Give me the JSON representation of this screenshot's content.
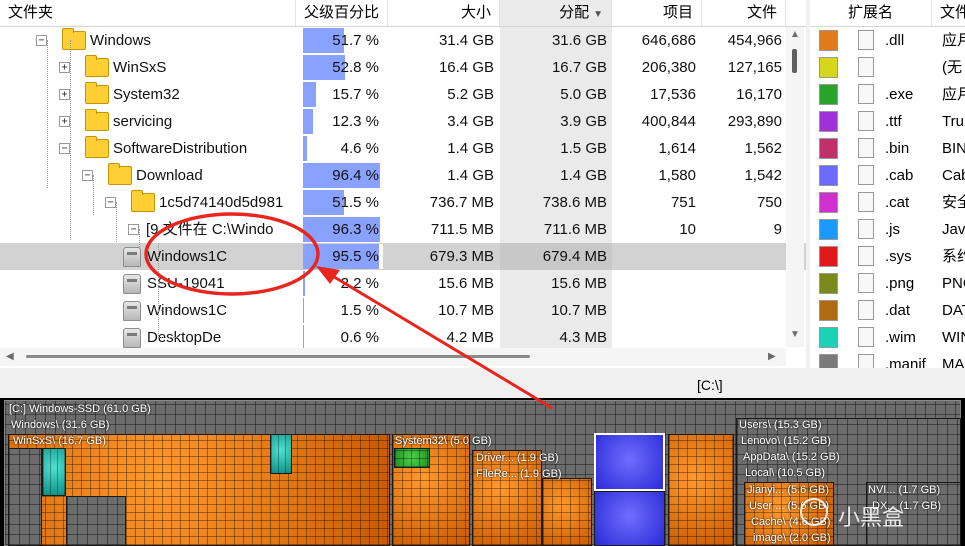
{
  "columns": {
    "folder": "文件夹",
    "parent_pct": "父级百分比",
    "size": "大小",
    "alloc": "分配",
    "items": "项目",
    "files": "文件"
  },
  "rows": [
    {
      "name": "Windows",
      "pct": "51.7 %",
      "pct_value": 0.517,
      "size": "31.4 GB",
      "alloc": "31.6 GB",
      "items": "646,686",
      "files": "454,966"
    },
    {
      "name": "WinSxS",
      "pct": "52.8 %",
      "pct_value": 0.528,
      "size": "16.4 GB",
      "alloc": "16.7 GB",
      "items": "206,380",
      "files": "127,165"
    },
    {
      "name": "System32",
      "pct": "15.7 %",
      "pct_value": 0.157,
      "size": "5.2 GB",
      "alloc": "5.0 GB",
      "items": "17,536",
      "files": "16,170"
    },
    {
      "name": "servicing",
      "pct": "12.3 %",
      "pct_value": 0.123,
      "size": "3.4 GB",
      "alloc": "3.9 GB",
      "items": "400,844",
      "files": "293,890"
    },
    {
      "name": "SoftwareDistribution",
      "pct": "4.6 %",
      "pct_value": 0.046,
      "size": "1.4 GB",
      "alloc": "1.5 GB",
      "items": "1,614",
      "files": "1,562"
    },
    {
      "name": "Download",
      "pct": "96.4 %",
      "pct_value": 0.964,
      "size": "1.4 GB",
      "alloc": "1.4 GB",
      "items": "1,580",
      "files": "1,542"
    },
    {
      "name": "1c5d74140d5d981",
      "pct": "51.5 %",
      "pct_value": 0.515,
      "size": "736.7 MB",
      "alloc": "738.6 MB",
      "items": "751",
      "files": "750"
    },
    {
      "name": "[9 文件在 C:\\Windo",
      "pct": "96.3 %",
      "pct_value": 0.963,
      "size": "711.5 MB",
      "alloc": "711.6 MB",
      "items": "10",
      "files": "9"
    },
    {
      "name": "Windows1C",
      "pct": "95.5 %",
      "pct_value": 0.955,
      "size": "679.3 MB",
      "alloc": "679.4 MB",
      "items": "",
      "files": ""
    },
    {
      "name": "SSU-19041",
      "pct": "2.2 %",
      "pct_value": 0.022,
      "size": "15.6 MB",
      "alloc": "15.6 MB",
      "items": "",
      "files": ""
    },
    {
      "name": "Windows1C",
      "pct": "1.5 %",
      "pct_value": 0.015,
      "size": "10.7 MB",
      "alloc": "10.7 MB",
      "items": "",
      "files": ""
    },
    {
      "name": "DesktopDe",
      "pct": "0.6 %",
      "pct_value": 0.006,
      "size": "4.2 MB",
      "alloc": "4.3 MB",
      "items": "",
      "files": ""
    }
  ],
  "ext_columns": {
    "ext": "扩展名",
    "desc": "文件"
  },
  "extensions": [
    {
      "ext": ".dll",
      "desc": "应月",
      "color": "#e07b1a"
    },
    {
      "ext": "",
      "desc": "(无",
      "color": "#d6d61a"
    },
    {
      "ext": ".exe",
      "desc": "应月",
      "color": "#2aa32a"
    },
    {
      "ext": ".ttf",
      "desc": "Tru",
      "color": "#a030d8"
    },
    {
      "ext": ".bin",
      "desc": "BIN",
      "color": "#c0306a"
    },
    {
      "ext": ".cab",
      "desc": "Cab",
      "color": "#6a6aff"
    },
    {
      "ext": ".cat",
      "desc": "安全",
      "color": "#d030d0"
    },
    {
      "ext": ".js",
      "desc": "Jav",
      "color": "#1a9aff"
    },
    {
      "ext": ".sys",
      "desc": "系约",
      "color": "#e01a1a"
    },
    {
      "ext": ".png",
      "desc": "PNC",
      "color": "#7a8a1a"
    },
    {
      "ext": ".dat",
      "desc": "DAT",
      "color": "#b06a10"
    },
    {
      "ext": ".wim",
      "desc": "WIN",
      "color": "#1ad2b8"
    },
    {
      "ext": ".manif",
      "desc": "MA",
      "color": "#7a7a7a"
    }
  ],
  "path": "[C:\\]",
  "treemap": {
    "root": "[C:] Windows-SSD (61.0 GB)",
    "windows": "Windows\\ (31.6 GB)",
    "winsxs": "WinSxS\\ (16.7 GB)",
    "system32": "System32\\ (5.0 GB)",
    "driver": "Driver... (1.9 GB)",
    "filere": "FileRe... (1.9 GB)",
    "users": "Users\\ (15.3 GB)",
    "lenovo": "Lenovo\\ (15.2 GB)",
    "appdata": "AppData\\ (15.2 GB)",
    "local": "Local\\ (10.5 GB)",
    "jianyi": "Jianyi... (5.6 GB)",
    "user": "User ... (5.6 GB)",
    "cache": "Cache\\ (4.6 GB)",
    "image": "image\\ (2.0 GB)",
    "nvi": "NVI... (1.7 GB)",
    "dx": "DX... (1.7 GB)"
  },
  "watermark": "小黑盒"
}
